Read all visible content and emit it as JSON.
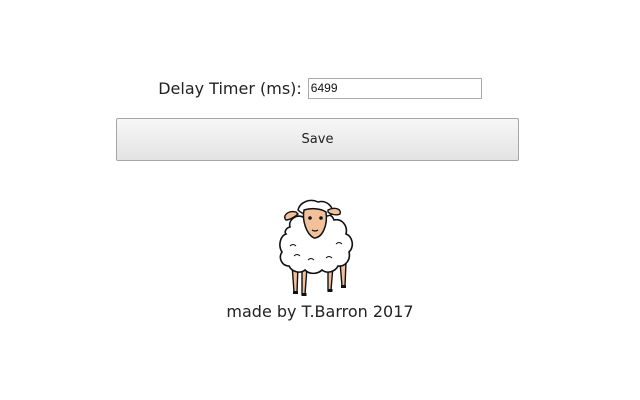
{
  "settings": {
    "delay_label": "Delay Timer (ms):",
    "delay_value": "6499",
    "save_label": "Save"
  },
  "footer": {
    "credit": "made by T.Barron 2017"
  },
  "illustration": {
    "icon": "sheep-icon"
  }
}
